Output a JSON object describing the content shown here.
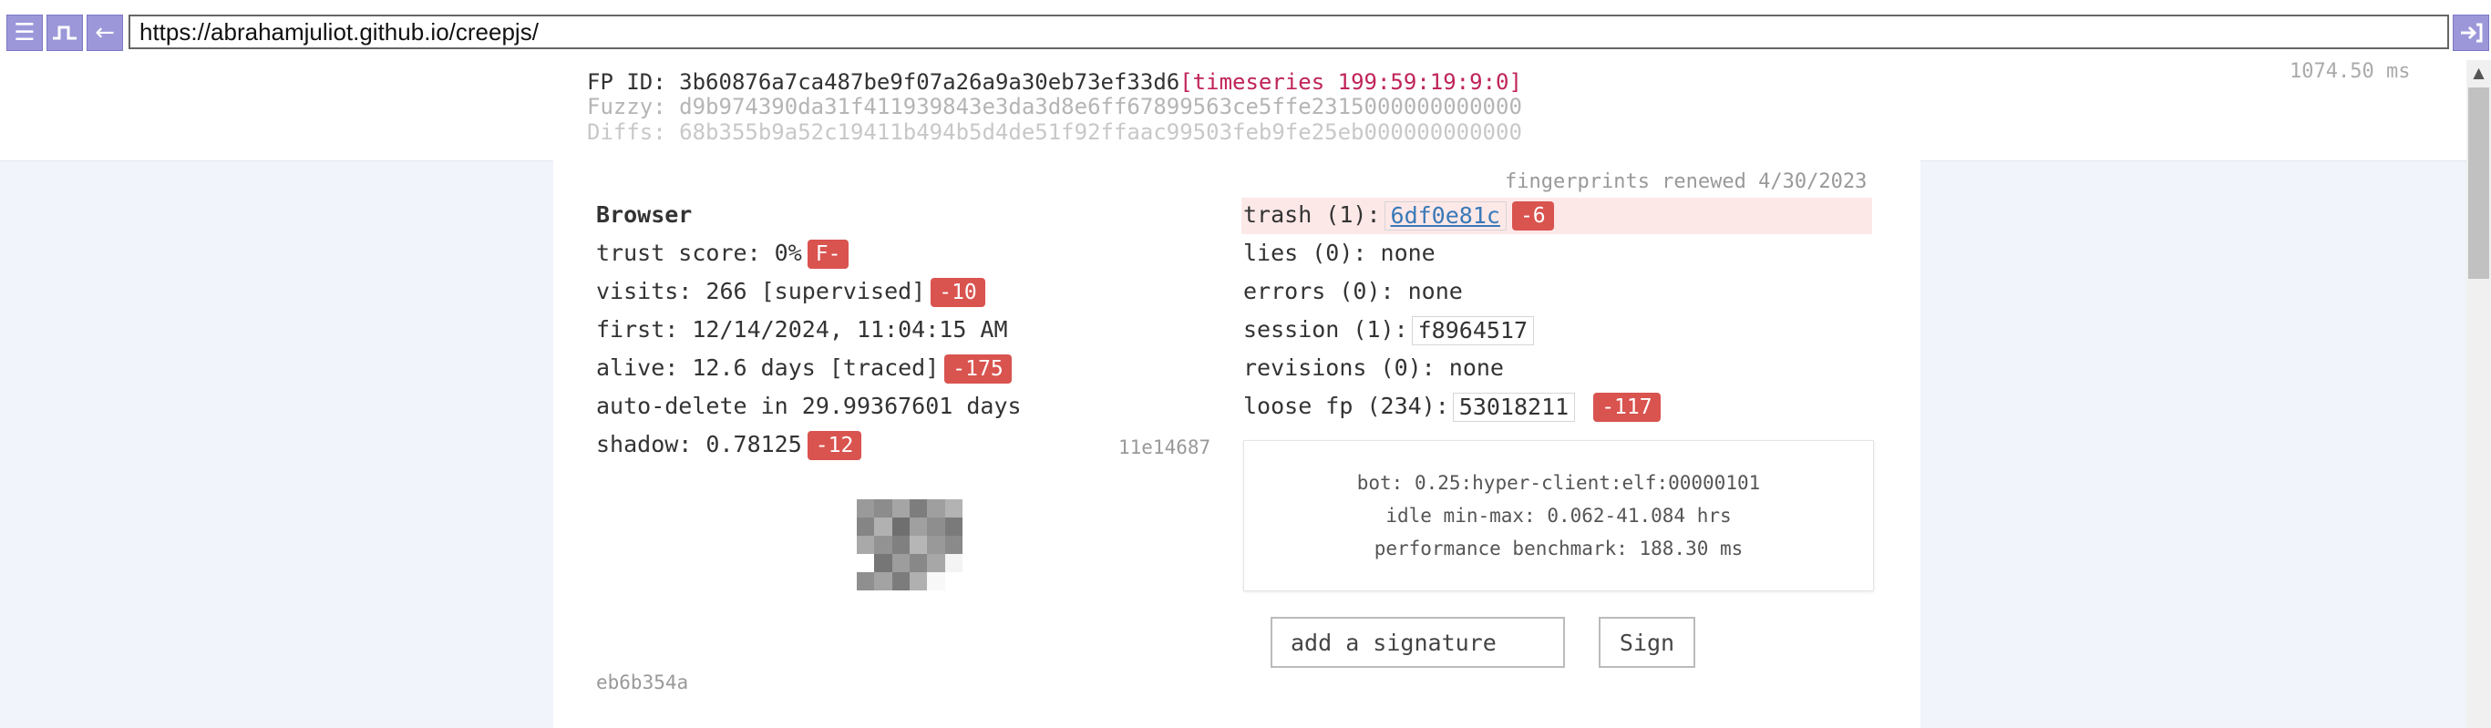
{
  "toolbar": {
    "menu_icon": "hamburger-menu-icon",
    "step_icon": "square-wave-icon",
    "back_icon": "back-arrow-icon",
    "exit_icon": "exit-arrow-icon",
    "url": "https://abrahamjuliot.github.io/creepjs/"
  },
  "fingerprint": {
    "id_label": "FP ID: ",
    "id_value": "3b60876a7ca487be9f07a26a9a30eb73ef33d6",
    "timeseries": "[timeseries 199:59:19:9:0]",
    "fuzzy": "Fuzzy: d9b974390da31f411939843e3da3d8e6ff67899563ce5ffe2315000000000000",
    "diffs": "Diffs: 68b355b9a52c19411b494b5d4de51f92ffaac99503feb9fe25eb000000000000",
    "timer": "1074.50 ms"
  },
  "renewed": "fingerprints renewed 4/30/2023",
  "browser": {
    "title": "Browser",
    "trust_score": "trust score: 0%",
    "trust_grade": "F-",
    "visits": "visits: 266 [supervised]",
    "visits_penalty": "-10",
    "first": "first: 12/14/2024, 11:04:15 AM",
    "alive": "alive: 12.6 days [traced]",
    "alive_penalty": "-175",
    "auto_delete": "auto-delete in 29.99367601 days",
    "shadow": "shadow: 0.78125",
    "shadow_penalty": "-12",
    "shadow_hash": "11e14687",
    "footer_hash": "eb6b354a"
  },
  "status": {
    "trash_label": "trash (1):",
    "trash_hash": "6df0e81c",
    "trash_penalty": "-6",
    "lies": "lies (0): none",
    "errors": "errors (0): none",
    "session_label": "session (1):",
    "session_hash": "f8964517",
    "revisions": "revisions (0): none",
    "loose_label": "loose fp (234):",
    "loose_hash": "53018211",
    "loose_penalty": "-117"
  },
  "bot": {
    "bot_line": "bot: 0.25:hyper-client:elf:00000101",
    "idle_line": "idle min-max: 0.062-41.084 hrs",
    "perf_line": "performance benchmark: 188.30 ms"
  },
  "signature": {
    "placeholder": "add a signature",
    "button": "Sign"
  },
  "colors": {
    "accent": "#9b97d9",
    "penalty": "#d9534f",
    "timeseries": "#c0245a",
    "trash_highlight": "#fde8e8"
  }
}
